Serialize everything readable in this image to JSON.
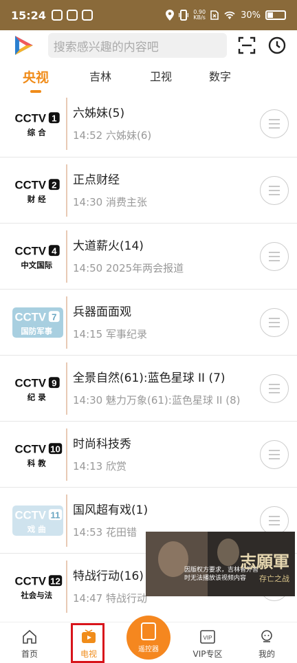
{
  "status_bar": {
    "time": "15:24",
    "speed": "0.90\nKB/s",
    "battery": "30%"
  },
  "search": {
    "placeholder": "搜索感兴趣的内容吧"
  },
  "tabs": [
    {
      "label": "央视",
      "active": true
    },
    {
      "label": "吉林",
      "active": false
    },
    {
      "label": "卫视",
      "active": false
    },
    {
      "label": "数字",
      "active": false
    }
  ],
  "channels": [
    {
      "logo_num": "1",
      "logo_sub": "综 合",
      "current": "六姊妹(5)",
      "next": "14:52 六姊妹(6)"
    },
    {
      "logo_num": "2",
      "logo_sub": "财 经",
      "current": "正点财经",
      "next": "14:30 消费主张"
    },
    {
      "logo_num": "4",
      "logo_sub": "中文国际",
      "current": "大道薪火(14)",
      "next": "14:50 2025年两会报道"
    },
    {
      "logo_num": "7",
      "logo_sub": "国防军事",
      "current": "兵器面面观",
      "next": "14:15 军事纪录"
    },
    {
      "logo_num": "9",
      "logo_sub": "纪 录",
      "current": "全景自然(61):蓝色星球 II (7)",
      "next": "14:30 魅力万象(61):蓝色星球 II (8)"
    },
    {
      "logo_num": "10",
      "logo_sub": "科 教",
      "current": "时尚科技秀",
      "next": "14:13 欣赏"
    },
    {
      "logo_num": "11",
      "logo_sub": "戏 曲",
      "current": "国风超有戏(1)",
      "next": "14:53 花田错"
    },
    {
      "logo_num": "12",
      "logo_sub": "社会与法",
      "current": "特战行动(16)",
      "next": "14:47 特战行动"
    }
  ],
  "video": {
    "notice": "因版权方要求，吉林省外暂时无法播放该视频内容",
    "title": "志願軍",
    "subtitle": "存亡之战"
  },
  "bottom_nav": {
    "home": "首页",
    "tv": "电视",
    "remote": "遥控器",
    "vip": "VIP专区",
    "mine": "我的"
  },
  "colors": {
    "accent": "#f08c1a",
    "status_bar": "#8a6a3a",
    "highlight": "#d8141b"
  }
}
